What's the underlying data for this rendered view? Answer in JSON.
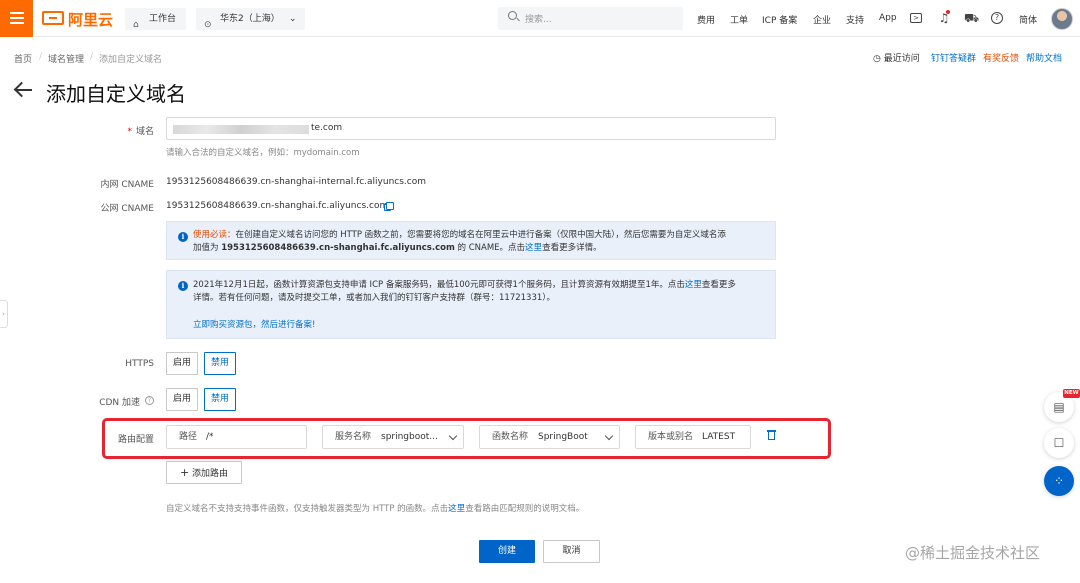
{
  "brand": {
    "logo_text": "阿里云",
    "accent": "#ff6a00",
    "link_color": "#0070cc",
    "primary": "#0064c8"
  },
  "topbar": {
    "workbench": "工作台",
    "region": "华东2（上海）",
    "search_placeholder": "搜索...",
    "nav": [
      "费用",
      "工单",
      "ICP 备案",
      "企业",
      "支持",
      "App"
    ],
    "lang": "简体",
    "icons": [
      "terminal-icon",
      "bell-icon",
      "cart-icon",
      "help-icon"
    ]
  },
  "breadcrumb": [
    "首页",
    "域名管理",
    "添加自定义域名"
  ],
  "header_links": {
    "recent": "最近访问",
    "dingtalk": "钉钉答疑群",
    "feedback": "有奖反馈",
    "docs": "帮助文档"
  },
  "page_title": "添加自定义域名",
  "form": {
    "domain_label": "域名",
    "domain_value_suffix": "te.com",
    "domain_help": "请输入合法的自定义域名，例如：mydomain.com",
    "internal_cname_label": "内网 CNAME",
    "internal_cname_value": "1953125608486639.cn-shanghai-internal.fc.aliyuncs.com",
    "public_cname_label": "公网 CNAME",
    "public_cname_value": "1953125608486639.cn-shanghai.fc.aliyuncs.com",
    "notice1": {
      "prefix": "使用必读：",
      "line1": "在创建自定义域名访问您的 HTTP 函数之前，您需要将您的域名在阿里云中进行备案（仅限中国大陆），然后您需要为自定义域名添",
      "line2_a": "加值为 ",
      "line2_bold": "1953125608486639.cn-shanghai.fc.aliyuncs.com",
      "line2_b": " 的 CNAME。点击",
      "line2_link": "这里",
      "line2_c": "查看更多详情。"
    },
    "notice2": {
      "line1_a": "2021年12月1日起，函数计算资源包支持申请 ICP 备案服务码，最低100元即可获得1个服务码，且计算资源有效期提至1年。点击",
      "line1_link": "这里",
      "line1_b": "查看更多",
      "line2": "详情。若有任何问题，请及时提交工单，或者加入我们的钉钉客户支持群（群号：11721331）。",
      "action_link": "立即购买资源包，然后进行备案!"
    },
    "https_label": "HTTPS",
    "cdn_label": "CDN 加速",
    "enable": "启用",
    "disable": "禁用",
    "route_label": "路由配置",
    "route": {
      "path_key": "路径",
      "path_value": "/*",
      "service_key": "服务名称",
      "service_value": "springboot...",
      "function_key": "函数名称",
      "function_value": "SpringBoot",
      "version_key": "版本或别名",
      "version_value": "LATEST"
    },
    "add_route": "添加路由",
    "footer_note_a": "自定义域名不支持支持事件函数，仅支持触发器类型为 HTTP 的函数。点击",
    "footer_note_link": "这里",
    "footer_note_b": "查看路由匹配规则的说明文档。",
    "create": "创建",
    "cancel": "取消"
  },
  "float_badge": "NEW",
  "watermark": "@稀土掘金技术社区"
}
